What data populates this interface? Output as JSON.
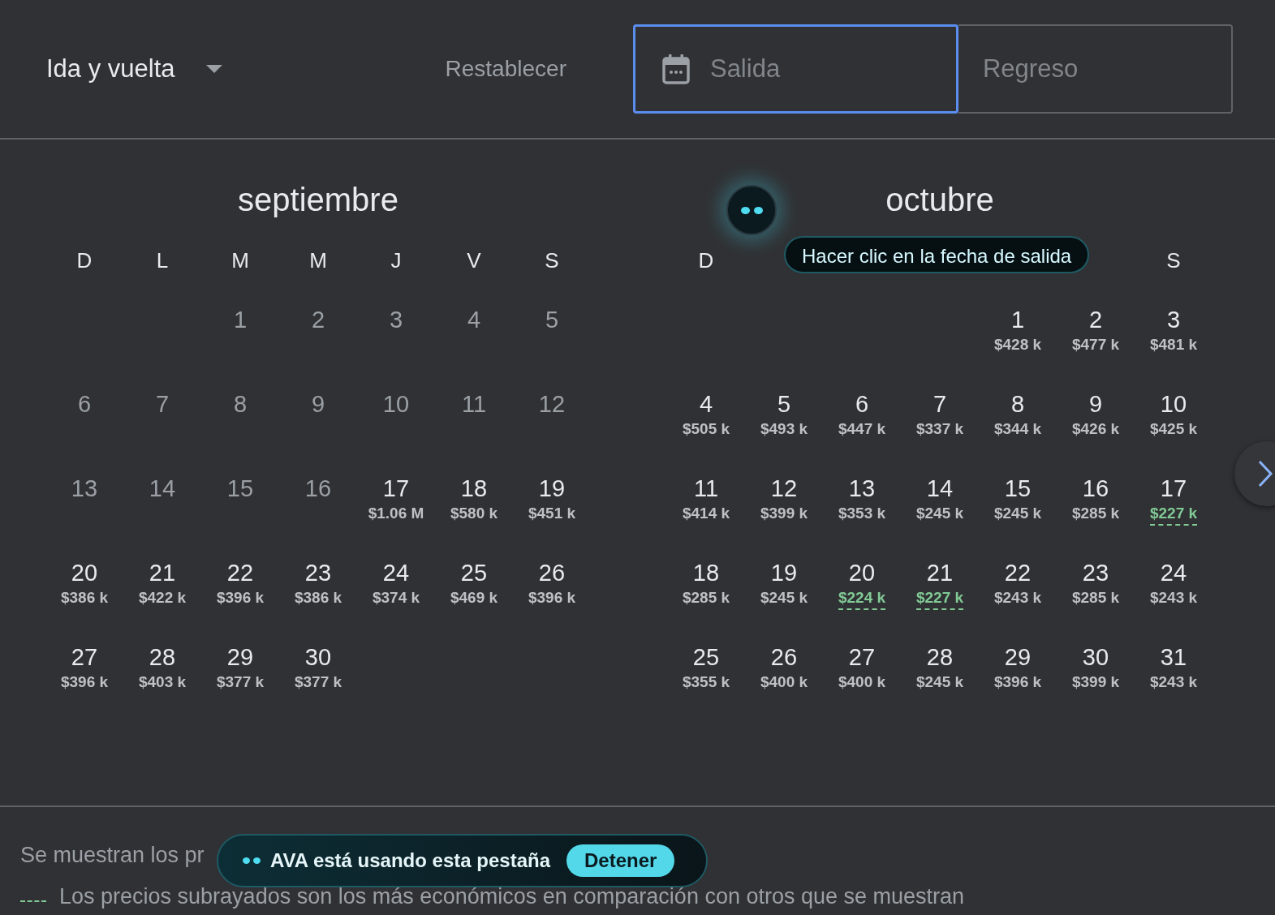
{
  "trip_type": {
    "value": "Ida y vuelta"
  },
  "reset_button": "Restablecer",
  "departure": {
    "placeholder": "Salida",
    "focused": true
  },
  "return": {
    "placeholder": "Regreso",
    "focused": false
  },
  "months": [
    {
      "title": "septiembre",
      "weekdays": [
        {
          "kind": "label",
          "text": "D"
        },
        {
          "kind": "label",
          "text": "L"
        },
        {
          "kind": "label",
          "text": "M"
        },
        {
          "kind": "label",
          "text": "M"
        },
        {
          "kind": "label",
          "text": "J"
        },
        {
          "kind": "label",
          "text": "V"
        },
        {
          "kind": "label",
          "text": "S"
        }
      ],
      "weeks": [
        [
          {
            "kind": "empty"
          },
          {
            "kind": "empty"
          },
          {
            "kind": "day",
            "day": "1",
            "disabled": true
          },
          {
            "kind": "day",
            "day": "2",
            "disabled": true
          },
          {
            "kind": "day",
            "day": "3",
            "disabled": true
          },
          {
            "kind": "day",
            "day": "4",
            "disabled": true
          },
          {
            "kind": "day",
            "day": "5",
            "disabled": true
          }
        ],
        [
          {
            "kind": "day",
            "day": "6",
            "disabled": true
          },
          {
            "kind": "day",
            "day": "7",
            "disabled": true
          },
          {
            "kind": "day",
            "day": "8",
            "disabled": true
          },
          {
            "kind": "day",
            "day": "9",
            "disabled": true
          },
          {
            "kind": "day",
            "day": "10",
            "disabled": true
          },
          {
            "kind": "day",
            "day": "11",
            "disabled": true
          },
          {
            "kind": "day",
            "day": "12",
            "disabled": true
          }
        ],
        [
          {
            "kind": "day",
            "day": "13",
            "disabled": true
          },
          {
            "kind": "day",
            "day": "14",
            "disabled": true
          },
          {
            "kind": "day",
            "day": "15",
            "disabled": true
          },
          {
            "kind": "day",
            "day": "16",
            "disabled": true
          },
          {
            "kind": "day",
            "day": "17",
            "disabled": false,
            "price": "$1.06 M",
            "cheapest": false
          },
          {
            "kind": "day",
            "day": "18",
            "disabled": false,
            "price": "$580 k",
            "cheapest": false
          },
          {
            "kind": "day",
            "day": "19",
            "disabled": false,
            "price": "$451 k",
            "cheapest": false
          }
        ],
        [
          {
            "kind": "day",
            "day": "20",
            "disabled": false,
            "price": "$386 k",
            "cheapest": false
          },
          {
            "kind": "day",
            "day": "21",
            "disabled": false,
            "price": "$422 k",
            "cheapest": false
          },
          {
            "kind": "day",
            "day": "22",
            "disabled": false,
            "price": "$396 k",
            "cheapest": false
          },
          {
            "kind": "day",
            "day": "23",
            "disabled": false,
            "price": "$386 k",
            "cheapest": false
          },
          {
            "kind": "day",
            "day": "24",
            "disabled": false,
            "price": "$374 k",
            "cheapest": false
          },
          {
            "kind": "day",
            "day": "25",
            "disabled": false,
            "price": "$469 k",
            "cheapest": false
          },
          {
            "kind": "day",
            "day": "26",
            "disabled": false,
            "price": "$396 k",
            "cheapest": false
          }
        ],
        [
          {
            "kind": "day",
            "day": "27",
            "disabled": false,
            "price": "$396 k",
            "cheapest": false
          },
          {
            "kind": "day",
            "day": "28",
            "disabled": false,
            "price": "$403 k",
            "cheapest": false
          },
          {
            "kind": "day",
            "day": "29",
            "disabled": false,
            "price": "$377 k",
            "cheapest": false
          },
          {
            "kind": "day",
            "day": "30",
            "disabled": false,
            "price": "$377 k",
            "cheapest": false
          },
          {
            "kind": "empty"
          },
          {
            "kind": "empty"
          },
          {
            "kind": "empty"
          }
        ]
      ]
    },
    {
      "title": "octubre",
      "weekdays": [
        {
          "kind": "label",
          "text": "D"
        },
        {
          "kind": "hidden"
        },
        {
          "kind": "hidden"
        },
        {
          "kind": "hidden"
        },
        {
          "kind": "hidden"
        },
        {
          "kind": "hidden"
        },
        {
          "kind": "label",
          "text": "S"
        }
      ],
      "weeks": [
        [
          {
            "kind": "empty"
          },
          {
            "kind": "empty"
          },
          {
            "kind": "empty"
          },
          {
            "kind": "empty"
          },
          {
            "kind": "day",
            "day": "1",
            "disabled": false,
            "price": "$428 k",
            "cheapest": false
          },
          {
            "kind": "day",
            "day": "2",
            "disabled": false,
            "price": "$477 k",
            "cheapest": false
          },
          {
            "kind": "day",
            "day": "3",
            "disabled": false,
            "price": "$481 k",
            "cheapest": false
          }
        ],
        [
          {
            "kind": "day",
            "day": "4",
            "disabled": false,
            "price": "$505 k",
            "cheapest": false
          },
          {
            "kind": "day",
            "day": "5",
            "disabled": false,
            "price": "$493 k",
            "cheapest": false
          },
          {
            "kind": "day",
            "day": "6",
            "disabled": false,
            "price": "$447 k",
            "cheapest": false
          },
          {
            "kind": "day",
            "day": "7",
            "disabled": false,
            "price": "$337 k",
            "cheapest": false
          },
          {
            "kind": "day",
            "day": "8",
            "disabled": false,
            "price": "$344 k",
            "cheapest": false
          },
          {
            "kind": "day",
            "day": "9",
            "disabled": false,
            "price": "$426 k",
            "cheapest": false
          },
          {
            "kind": "day",
            "day": "10",
            "disabled": false,
            "price": "$425 k",
            "cheapest": false
          }
        ],
        [
          {
            "kind": "day",
            "day": "11",
            "disabled": false,
            "price": "$414 k",
            "cheapest": false
          },
          {
            "kind": "day",
            "day": "12",
            "disabled": false,
            "price": "$399 k",
            "cheapest": false
          },
          {
            "kind": "day",
            "day": "13",
            "disabled": false,
            "price": "$353 k",
            "cheapest": false
          },
          {
            "kind": "day",
            "day": "14",
            "disabled": false,
            "price": "$245 k",
            "cheapest": false
          },
          {
            "kind": "day",
            "day": "15",
            "disabled": false,
            "price": "$245 k",
            "cheapest": false
          },
          {
            "kind": "day",
            "day": "16",
            "disabled": false,
            "price": "$285 k",
            "cheapest": false
          },
          {
            "kind": "day",
            "day": "17",
            "disabled": false,
            "price": "$227 k",
            "cheapest": true
          }
        ],
        [
          {
            "kind": "day",
            "day": "18",
            "disabled": false,
            "price": "$285 k",
            "cheapest": false
          },
          {
            "kind": "day",
            "day": "19",
            "disabled": false,
            "price": "$245 k",
            "cheapest": false
          },
          {
            "kind": "day",
            "day": "20",
            "disabled": false,
            "price": "$224 k",
            "cheapest": true
          },
          {
            "kind": "day",
            "day": "21",
            "disabled": false,
            "price": "$227 k",
            "cheapest": true
          },
          {
            "kind": "day",
            "day": "22",
            "disabled": false,
            "price": "$243 k",
            "cheapest": false
          },
          {
            "kind": "day",
            "day": "23",
            "disabled": false,
            "price": "$285 k",
            "cheapest": false
          },
          {
            "kind": "day",
            "day": "24",
            "disabled": false,
            "price": "$243 k",
            "cheapest": false
          }
        ],
        [
          {
            "kind": "day",
            "day": "25",
            "disabled": false,
            "price": "$355 k",
            "cheapest": false
          },
          {
            "kind": "day",
            "day": "26",
            "disabled": false,
            "price": "$400 k",
            "cheapest": false
          },
          {
            "kind": "day",
            "day": "27",
            "disabled": false,
            "price": "$400 k",
            "cheapest": false
          },
          {
            "kind": "day",
            "day": "28",
            "disabled": false,
            "price": "$245 k",
            "cheapest": false
          },
          {
            "kind": "day",
            "day": "29",
            "disabled": false,
            "price": "$396 k",
            "cheapest": false
          },
          {
            "kind": "day",
            "day": "30",
            "disabled": false,
            "price": "$399 k",
            "cheapest": false
          },
          {
            "kind": "day",
            "day": "31",
            "disabled": false,
            "price": "$243 k",
            "cheapest": false
          }
        ]
      ]
    }
  ],
  "tooltip": "Hacer clic en la fecha de salida",
  "footer": {
    "note": "Se muestran los pr",
    "legend": "Los precios subrayados son los más económicos en comparación con otros que se muestran"
  },
  "agent_banner": {
    "text": "AVA está usando esta pestaña",
    "button": "Detener"
  }
}
